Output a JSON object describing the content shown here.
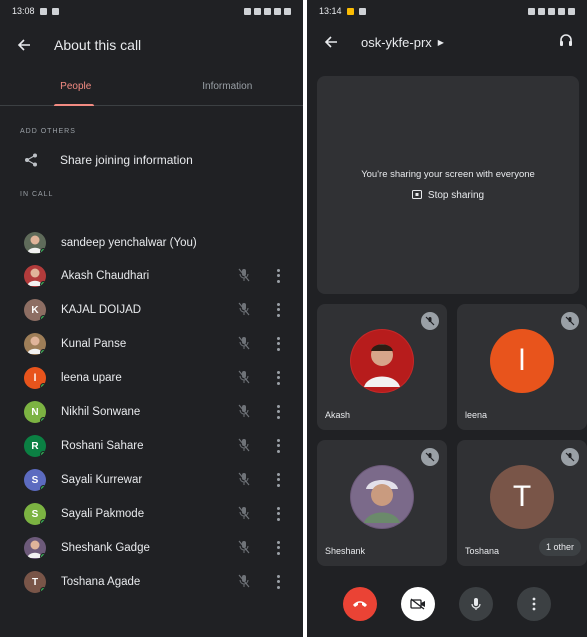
{
  "left_screen": {
    "status_time": "13:08",
    "title": "About this call",
    "tabs": [
      {
        "label": "People",
        "active": true
      },
      {
        "label": "Information",
        "active": false
      }
    ],
    "add_others_heading": "ADD OTHERS",
    "share_label": "Share joining information",
    "in_call_heading": "IN CALL",
    "participants": [
      {
        "name": "sandeep yenchalwar (You)",
        "initial": "",
        "color": "#5f6b5a",
        "icon": "photo-avatar",
        "muted": false
      },
      {
        "name": "Akash Chaudhari",
        "initial": "",
        "color": "#b23b3b",
        "icon": "photo-avatar",
        "muted": true
      },
      {
        "name": "KAJAL DOIJAD",
        "initial": "K",
        "color": "#8d6e63",
        "icon": "letter-avatar",
        "muted": true
      },
      {
        "name": "Kunal Panse",
        "initial": "",
        "color": "#9e7e58",
        "icon": "photo-avatar",
        "muted": true
      },
      {
        "name": "leena upare",
        "initial": "l",
        "color": "#e8541c",
        "icon": "letter-avatar",
        "muted": true
      },
      {
        "name": "Nikhil Sonwane",
        "initial": "N",
        "color": "#7cb342",
        "icon": "letter-avatar",
        "muted": true
      },
      {
        "name": "Roshani Sahare",
        "initial": "R",
        "color": "#0b8043",
        "icon": "letter-avatar",
        "muted": true
      },
      {
        "name": "Sayali Kurrewar",
        "initial": "S",
        "color": "#5c6bc0",
        "icon": "letter-avatar",
        "muted": true
      },
      {
        "name": "Sayali Pakmode",
        "initial": "S",
        "color": "#7cb342",
        "icon": "letter-avatar",
        "muted": true
      },
      {
        "name": "Sheshank Gadge",
        "initial": "",
        "color": "#6d5a7a",
        "icon": "photo-avatar",
        "muted": true
      },
      {
        "name": "Toshana Agade",
        "initial": "T",
        "color": "#795548",
        "icon": "letter-avatar",
        "muted": true
      }
    ]
  },
  "right_screen": {
    "status_time": "13:14",
    "meeting_code": "osk-ykfe-prx",
    "sharing_text": "You're sharing your screen with everyone",
    "stop_sharing_label": "Stop sharing",
    "tiles": [
      {
        "name": "Akash",
        "initial": "",
        "color": "#c62828",
        "muted": true
      },
      {
        "name": "leena",
        "initial": "l",
        "color": "#e8541c",
        "muted": true
      },
      {
        "name": "Sheshank",
        "initial": "",
        "color": "#6d5a7a",
        "muted": true
      },
      {
        "name": "Toshana",
        "initial": "T",
        "color": "#795548",
        "muted": true
      }
    ],
    "other_chip": "1 other"
  }
}
